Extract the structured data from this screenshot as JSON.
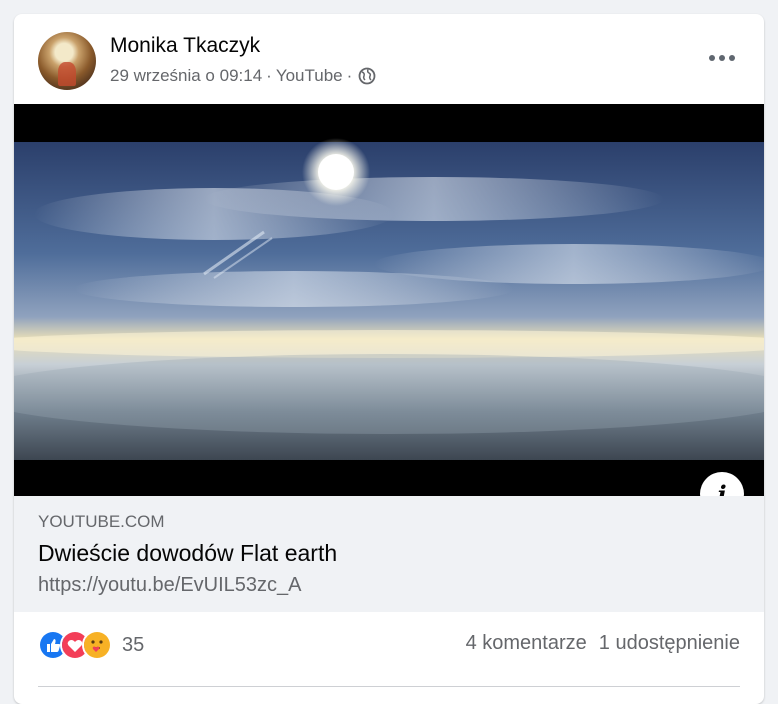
{
  "post": {
    "author": "Monika Tkaczyk",
    "date": "29 września o 09:14",
    "separator": "·",
    "source": "YouTube",
    "privacy_icon": "globe-icon",
    "more_icon": "more-options-icon"
  },
  "link": {
    "domain": "YOUTUBE.COM",
    "title": "Dwieście dowodów Flat earth",
    "url": "https://youtu.be/EvUIL53zc_A",
    "info_label": "i"
  },
  "footer": {
    "reaction_icons": [
      "like-icon",
      "love-icon",
      "care-icon"
    ],
    "reaction_count": "35",
    "comments": "4 komentarze",
    "shares": "1 udostępnienie"
  },
  "colors": {
    "like": "#1877f2",
    "love": "#f33e58",
    "care": "#f7b125"
  }
}
